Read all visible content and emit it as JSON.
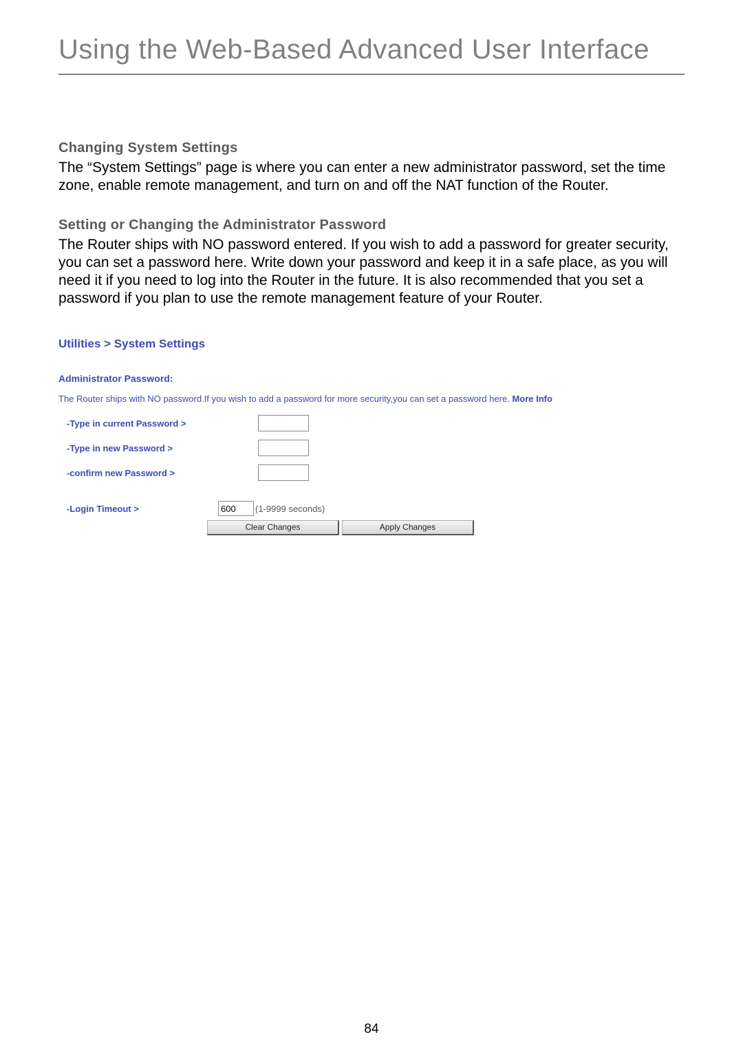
{
  "main_title": "Using the Web-Based Advanced User Interface",
  "section1": {
    "heading": "Changing System Settings",
    "body": "The “System Settings” page is where you can enter a new administrator password, set the time zone, enable remote management, and turn on and off the NAT function of the Router."
  },
  "section2": {
    "heading": "Setting or Changing the Administrator Password",
    "body": "The Router ships with NO password entered. If you wish to add a password for greater security, you can set a password here. Write down your password and keep it in a safe place, as you will need it if you need to log into the Router in the future. It is also recommended that you set a password if you plan to use the remote management feature of your Router."
  },
  "panel": {
    "breadcrumb": "Utilities > System Settings",
    "subheading": "Administrator Password:",
    "desc_prefix": "The Router ships with NO password.If you wish to add a password for more security,you can set a password here. ",
    "more_info": "More Info",
    "fields": {
      "current_password_label": "-Type in current Password >",
      "new_password_label": "-Type in new Password >",
      "confirm_password_label": "-confirm new Password >",
      "login_timeout_label": "-Login Timeout >",
      "login_timeout_value": "600",
      "login_timeout_hint": "(1-9999 seconds)"
    },
    "buttons": {
      "clear": "Clear Changes",
      "apply": "Apply Changes"
    }
  },
  "page_number": "84"
}
